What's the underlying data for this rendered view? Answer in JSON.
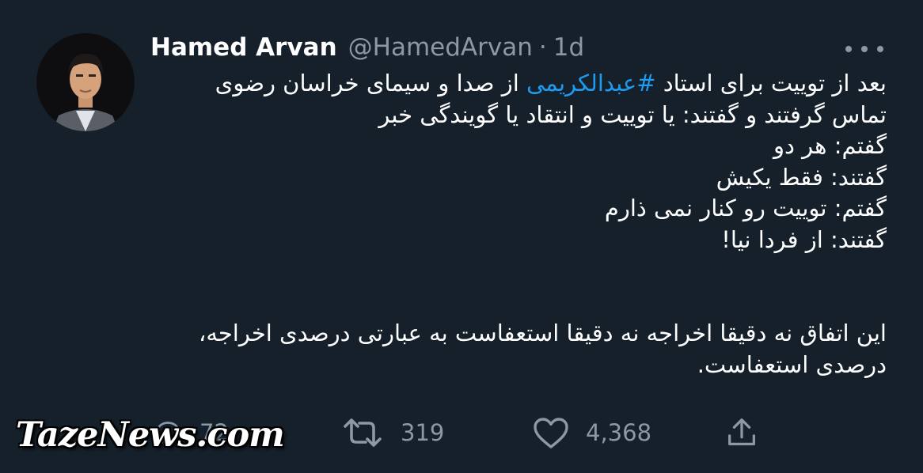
{
  "tweet": {
    "author_name": "Hamed Arvan",
    "handle": "@HamedArvan",
    "separator": "·",
    "time": "1d",
    "body": {
      "line1_prefix": "بعد از توییت برای استاد ",
      "hashtag": "#عبدالکریمی",
      "line1_suffix": " از صدا و سیمای خراسان رضوی",
      "line2": "تماس گرفتند و گفتند: یا توییت و انتقاد یا گویندگی خبر",
      "line3": "گفتم: هر دو",
      "line4": "گفتند: فقط یکیش",
      "line5": "گفتم: توییت رو کنار نمی ذارم",
      "line6": "گفتند: از فردا نیا!",
      "line7": "این اتفاق نه دقیقا اخراجه نه دقیقا استعفاست به عبارتی درصدی اخراجه،",
      "line8": "درصدی استعفاست."
    },
    "actions": {
      "reply_count": "72",
      "retweet_count": "319",
      "like_count": "4,368"
    }
  },
  "watermark": {
    "text": "TazeNews.com"
  },
  "colors": {
    "background": "#15202b",
    "text": "#ffffff",
    "secondary": "#8b98a5",
    "accent": "#1d9bf0"
  },
  "icons": [
    "more-icon",
    "reply-icon",
    "retweet-icon",
    "like-icon",
    "share-icon"
  ]
}
